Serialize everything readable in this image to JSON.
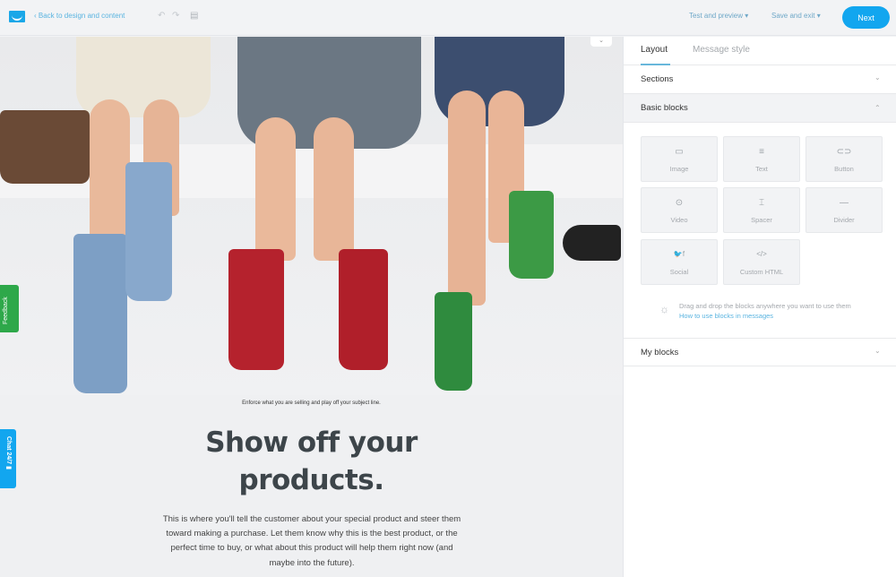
{
  "topbar": {
    "logo_icon": "envelope-logo-icon",
    "back_label": "‹  Back to design and content",
    "undo_icon": "↶",
    "redo_icon": "↷",
    "save_icon": "▤",
    "test_preview_label": "Test and preview ▾",
    "save_exit_label": "Save and exit ▾",
    "next_label": "Next"
  },
  "canvas": {
    "fold_icon": "⌄",
    "preheader": "Enforce what you are selling and play off your subject line.",
    "headline": "Show off your products.",
    "body": "This is where you'll tell the customer about your special product and steer them toward making a purchase. Let them know why this is the best product, or the perfect time to buy, or what about this product will help them right now (and maybe into the future).",
    "feedback_label": "Feedback",
    "chat_label": "Chat 24/7  ▮"
  },
  "panel": {
    "tabs": [
      {
        "label": "Layout",
        "active": true
      },
      {
        "label": "Message style",
        "active": false
      }
    ],
    "sections_label": "Sections",
    "basic_blocks_label": "Basic blocks",
    "my_blocks_label": "My blocks",
    "chevron_down": "⌄",
    "chevron_up": "⌃",
    "blocks": [
      {
        "label": "Image",
        "icon": "▭"
      },
      {
        "label": "Text",
        "icon": "≡"
      },
      {
        "label": "Button",
        "icon": "⊂⊃"
      },
      {
        "label": "Video",
        "icon": "⊙"
      },
      {
        "label": "Spacer",
        "icon": "⌶"
      },
      {
        "label": "Divider",
        "icon": "—"
      },
      {
        "label": "Social",
        "icon": "🐦f"
      },
      {
        "label": "Custom HTML",
        "icon": "</>"
      }
    ],
    "hint_icon": "☼",
    "hint_text": "Drag and drop the blocks anywhere you want to use them",
    "hint_link": "How to use blocks in messages"
  },
  "colors": {
    "accent": "#12a6ef",
    "feedback": "#2ea84a",
    "link": "#5ab4e0"
  }
}
